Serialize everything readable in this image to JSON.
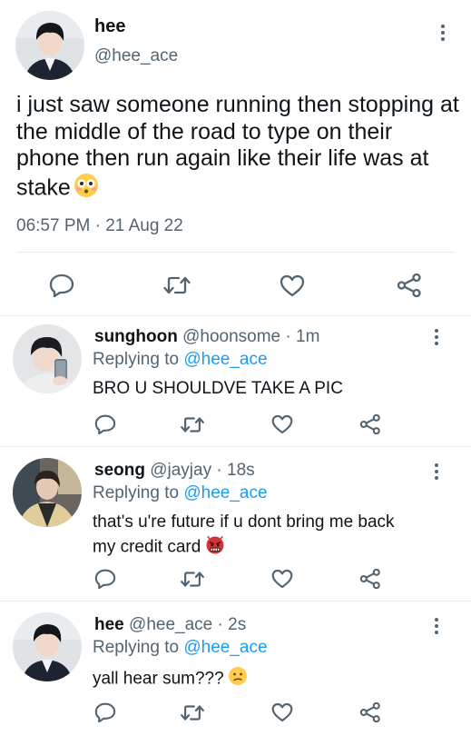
{
  "main_tweet": {
    "display_name": "hee",
    "handle": "@hee_ace",
    "text": "i just saw someone running then stopping at the middle of the road to type on their phone then run again like their life was at stake",
    "emoji": "flushed-face",
    "timestamp": "06:57 PM · 21 Aug 22",
    "actions": [
      "reply",
      "retweet",
      "like",
      "share"
    ]
  },
  "replies": [
    {
      "display_name": "sunghoon",
      "handle": "@hoonsome",
      "separator": "·",
      "time": "1m",
      "replying_prefix": "Replying to",
      "replying_handle": "@hee_ace",
      "text": "BRO U SHOULDVE TAKE A PIC"
    },
    {
      "display_name": "seong",
      "handle": "@jayjay",
      "separator": "·",
      "time": "18s",
      "replying_prefix": "Replying to",
      "replying_handle": "@hee_ace",
      "text_line1": "that's u're future if u dont bring me back",
      "text_line2": "my credit card",
      "emoji": "angry-devil"
    },
    {
      "display_name": "hee",
      "handle": "@hee_ace",
      "separator": "·",
      "time": "2s",
      "replying_prefix": "Replying to",
      "replying_handle": "@hee_ace",
      "text": "yall hear sum???",
      "emoji": "confused-face"
    }
  ],
  "colors": {
    "text": "#0f1419",
    "secondary": "#536471",
    "link": "#1d9bf0",
    "divider": "#e6ecf0",
    "devil": "#d1343a"
  }
}
